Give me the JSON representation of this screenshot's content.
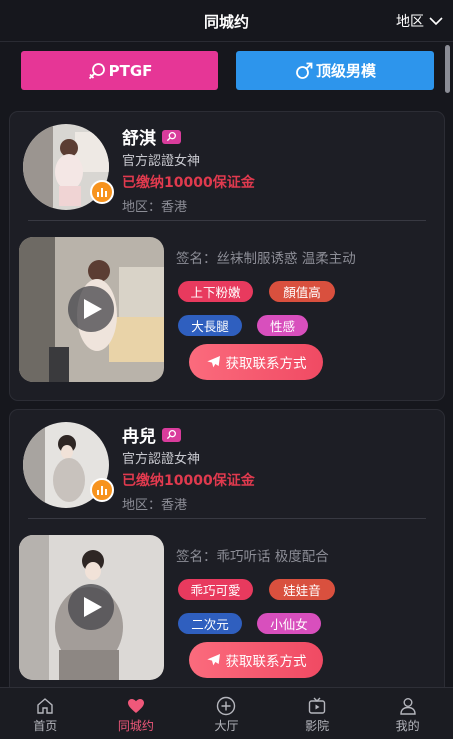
{
  "header": {
    "title": "同城约",
    "region_label": "地区"
  },
  "segments": {
    "female_label": "PTGF",
    "male_label": "顶级男模"
  },
  "colors": {
    "female": "#e63696",
    "male": "#2d95ec",
    "deposit": "#e03a4e",
    "accent": "#f0587a"
  },
  "cards": [
    {
      "name": "舒淇",
      "cert": "官方認證女神",
      "deposit": "已缴纳10000保证金",
      "region": "地区：香港",
      "signature": "签名：丝袜制服诱惑 温柔主动",
      "tags": [
        {
          "label": "上下粉嫩",
          "color": "#e83a5e"
        },
        {
          "label": "顏值高",
          "color": "#d9503e"
        },
        {
          "label": "大長腿",
          "color": "#2f5fbf"
        },
        {
          "label": "性感",
          "color": "#d84fbd"
        }
      ],
      "contact_label": "获取联系方式"
    },
    {
      "name": "冉兒",
      "cert": "官方認證女神",
      "deposit": "已缴纳10000保证金",
      "region": "地区：香港",
      "signature": "签名：乖巧听话 极度配合",
      "tags": [
        {
          "label": "乖巧可愛",
          "color": "#e83a5e"
        },
        {
          "label": "娃娃音",
          "color": "#d9503e"
        },
        {
          "label": "二次元",
          "color": "#2f5fbf"
        },
        {
          "label": "小仙女",
          "color": "#d84fbd"
        }
      ],
      "contact_label": "获取联系方式"
    }
  ],
  "tabbar": [
    {
      "label": "首页",
      "icon": "home-icon"
    },
    {
      "label": "同城约",
      "icon": "heart-icon"
    },
    {
      "label": "大厅",
      "icon": "plus-circle-icon"
    },
    {
      "label": "影院",
      "icon": "tv-icon"
    },
    {
      "label": "我的",
      "icon": "user-icon"
    }
  ]
}
